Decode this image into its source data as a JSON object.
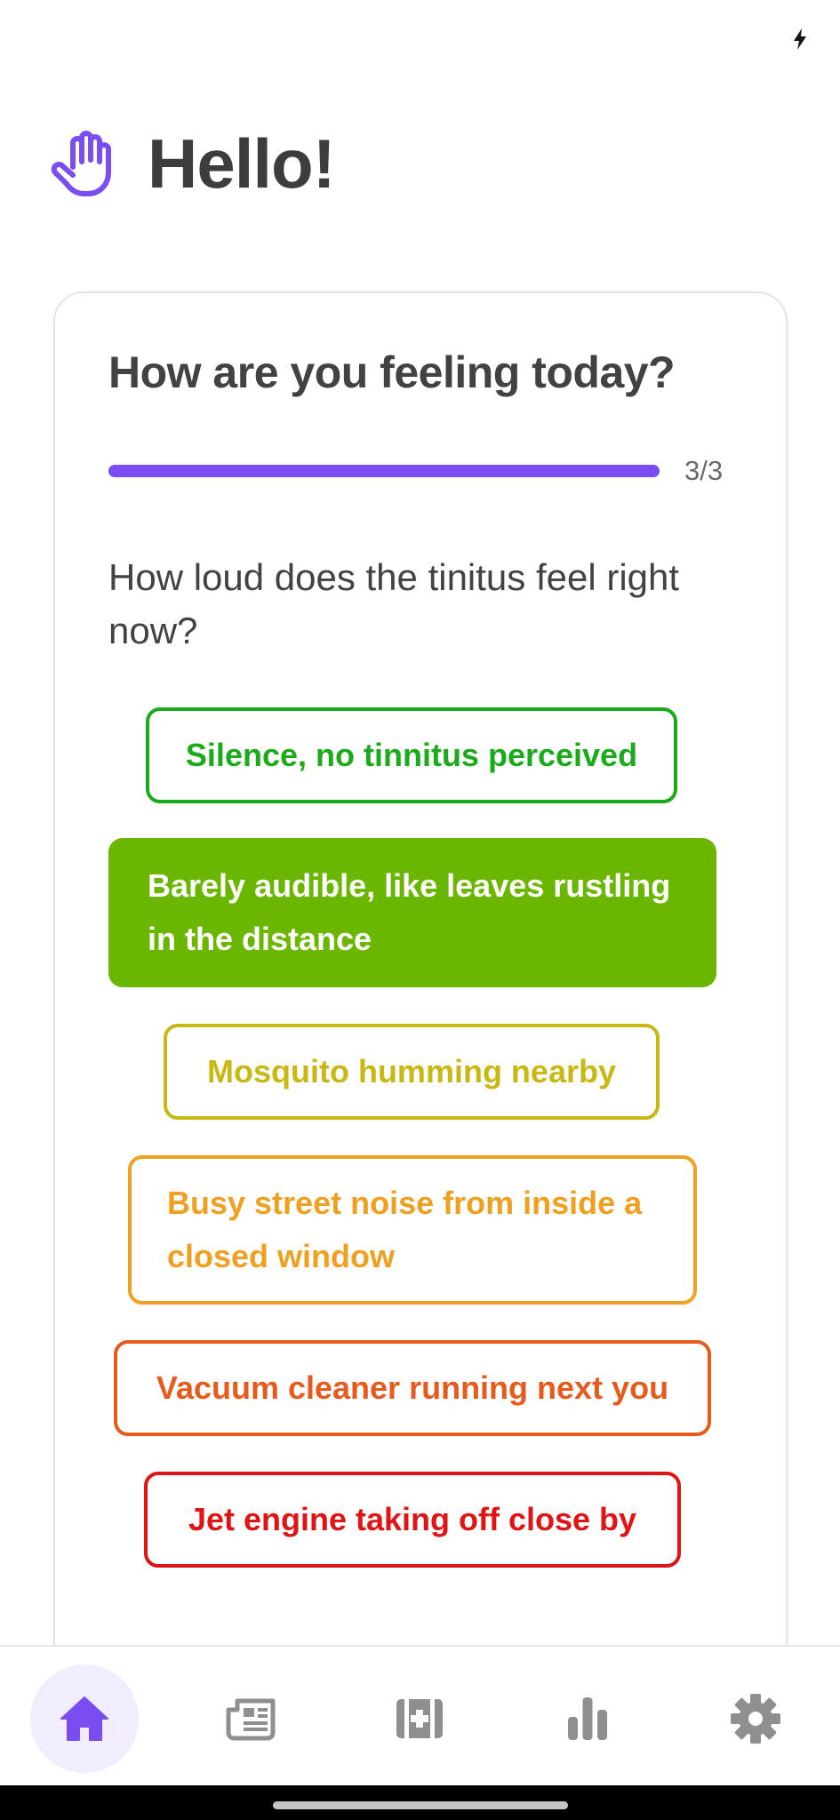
{
  "colors": {
    "accent": "#7a4df0",
    "option_green": "#1aaa1a",
    "option_lime": "#6bb600",
    "option_yellow": "#c9b713",
    "option_orange": "#f0a020",
    "option_deep_orange": "#e65a1c",
    "option_red": "#e01414"
  },
  "greeting": {
    "icon": "waving-hand-icon",
    "title": "Hello!"
  },
  "card": {
    "title": "How are you feeling today?",
    "progress": {
      "label": "3/3",
      "fraction": 1.0
    },
    "question": "How loud does the tinitus feel right now?",
    "options": [
      {
        "label": "Silence, no tinnitus perceived",
        "color": "#1aaa1a",
        "selected": false
      },
      {
        "label": "Barely audible, like leaves rustling in the distance",
        "color": "#6bb600",
        "selected": true
      },
      {
        "label": "Mosquito humming nearby",
        "color": "#c9b713",
        "selected": false
      },
      {
        "label": "Busy street noise from inside a closed window",
        "color": "#f0a020",
        "selected": false
      },
      {
        "label": "Vacuum cleaner running next you",
        "color": "#e65a1c",
        "selected": false
      },
      {
        "label": "Jet engine taking off close by",
        "color": "#e01414",
        "selected": false
      }
    ]
  },
  "bottom_nav": {
    "items": [
      {
        "icon": "home-icon",
        "active": true
      },
      {
        "icon": "newspaper-icon",
        "active": false
      },
      {
        "icon": "medical-kit-icon",
        "active": false
      },
      {
        "icon": "bar-chart-icon",
        "active": false
      },
      {
        "icon": "gear-icon",
        "active": false
      }
    ]
  },
  "status_bar": {
    "icon": "charging-bolt-icon"
  }
}
